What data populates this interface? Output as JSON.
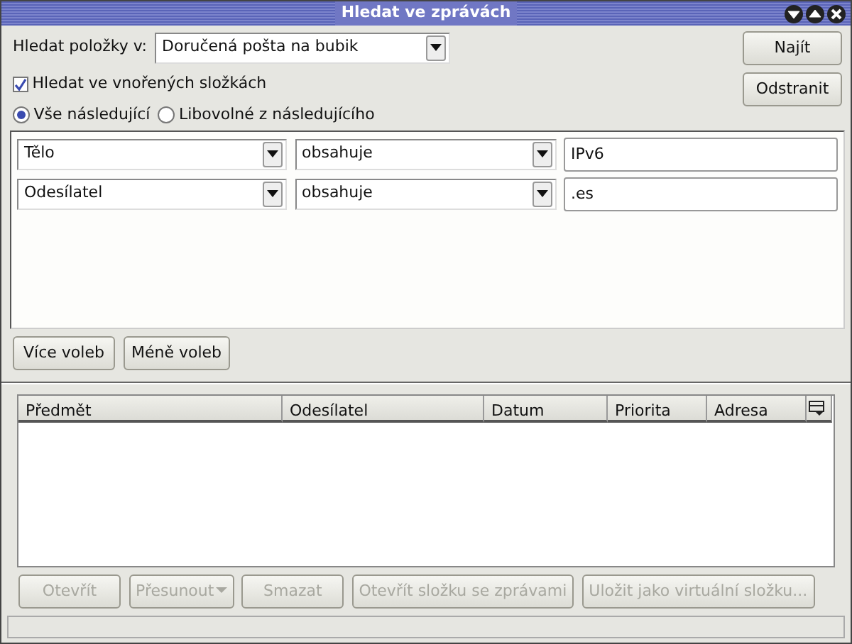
{
  "window": {
    "title": "Hledat ve zprávách"
  },
  "search_in": {
    "label": "Hledat položky v:",
    "value": "Doručená pošta na bubik"
  },
  "subfolders": {
    "label": "Hledat ve vnořených složkách",
    "checked": true
  },
  "match": [
    {
      "label": "Vše následující",
      "selected": true
    },
    {
      "label": "Libovolné z následujícího",
      "selected": false
    }
  ],
  "criteria": [
    {
      "field": "Tělo",
      "operator": "obsahuje",
      "value": "IPv6"
    },
    {
      "field": "Odesílatel",
      "operator": "obsahuje",
      "value": ".es"
    }
  ],
  "criteria_buttons": [
    {
      "label": "Více voleb"
    },
    {
      "label": "Méně voleb"
    }
  ],
  "side_buttons": [
    {
      "label": "Najít"
    },
    {
      "label": "Odstranit"
    }
  ],
  "table": {
    "columns": [
      "Předmět",
      "Odesílatel",
      "Datum",
      "Priorita",
      "Adresa"
    ]
  },
  "actions": [
    {
      "label": "Otevřít",
      "disabled": true,
      "kind": "plain"
    },
    {
      "label": "Přesunout",
      "disabled": true,
      "kind": "menu"
    },
    {
      "label": "Smazat",
      "disabled": true,
      "kind": "plain"
    },
    {
      "label": "Otevřít složku se zprávami",
      "disabled": true,
      "kind": "plain"
    },
    {
      "label": "Uložit jako virtuální složku...",
      "disabled": true,
      "kind": "plain"
    }
  ]
}
